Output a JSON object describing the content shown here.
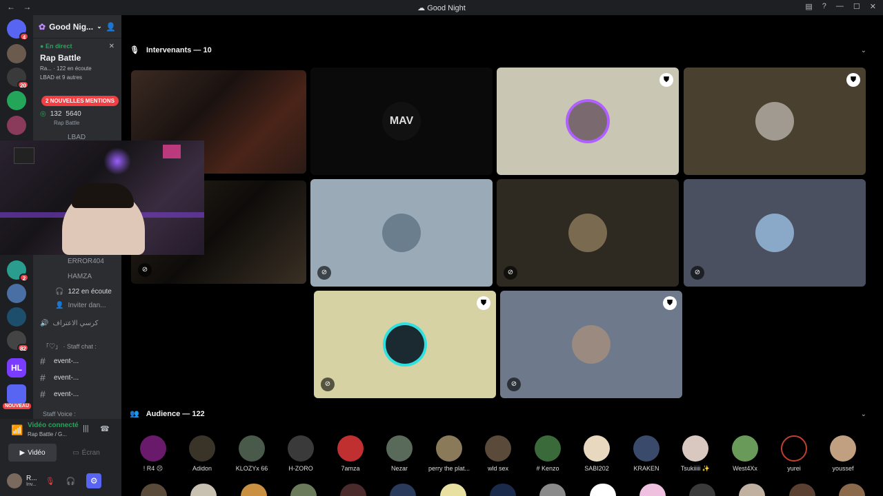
{
  "window": {
    "title": "Good Night"
  },
  "server": {
    "name": "Good Nig...",
    "live_label": "En direct",
    "event_title": "Rap Battle",
    "event_info": "Ra... · 122 en écoute",
    "event_hosts": "LBAD et 9 autres"
  },
  "mentions_label": "2 NOUVELLES MENTIONS",
  "stage": {
    "count_a": "132",
    "count_b": "5640",
    "name": "Rap Battle",
    "host": "LBAD"
  },
  "channel_list": [
    {
      "name": "ERROR404"
    },
    {
      "name": "HAMZA"
    },
    {
      "name": "122 en écoute"
    },
    {
      "name": "Inviter dan..."
    },
    {
      "name": "كرسي الاعتراف"
    },
    {
      "name": "「♡」 · Staff chat :"
    },
    {
      "name": "event-..."
    },
    {
      "name": "event-..."
    },
    {
      "name": "event-..."
    },
    {
      "name": "Staff Voice :"
    }
  ],
  "guild_badges": {
    "top": "4",
    "b1": "20",
    "b2": "2",
    "b3": "82",
    "new": "NOUVEAU"
  },
  "voice": {
    "status": "Vidéo connecté",
    "sub": "Rap Battle / G...",
    "video_label": "Vidéo",
    "screen_label": "Écran"
  },
  "user": {
    "name": "R...",
    "status": "Inv..."
  },
  "speakers": {
    "header": "Intervenants — 10"
  },
  "audience": {
    "header": "Audience — 122",
    "members": [
      "! R4 ☹",
      "Adidon",
      "KLOZYx 66",
      "H-ZORO",
      "7amza",
      "Nezar",
      "perry the plat...",
      "wld sex",
      "# Kenzo",
      "SABI202",
      "KRAKEN",
      "Tsukiiiii ✨",
      "West4Xx",
      "yurei",
      "youssef"
    ]
  },
  "tile_logo": "MAV",
  "colors": {
    "accent": "#5865f2",
    "online": "#23a55a",
    "danger": "#f23f43"
  }
}
